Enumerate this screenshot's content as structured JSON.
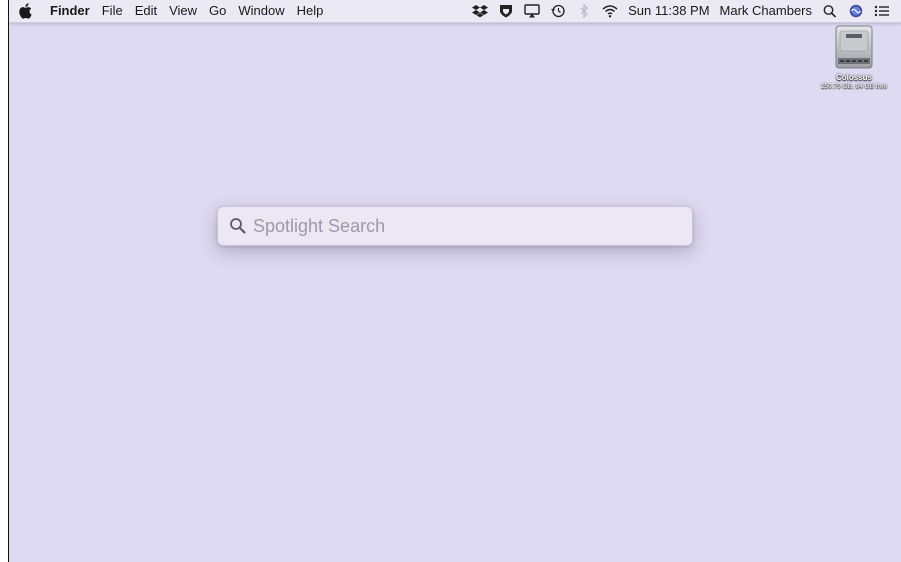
{
  "menubar": {
    "apple_icon": "apple-logo-icon",
    "app_name": "Finder",
    "menus": [
      "File",
      "Edit",
      "View",
      "Go",
      "Window",
      "Help"
    ],
    "tray": {
      "icons": [
        "dropbox-icon",
        "shield-icon",
        "airplay-icon",
        "time-machine-icon",
        "bluetooth-icon",
        "wifi-icon"
      ],
      "clock": "Sun 11:38 PM",
      "user": "Mark Chambers",
      "right_icons": [
        "search-icon",
        "siri-icon",
        "notification-center-icon"
      ]
    }
  },
  "desktop": {
    "background_color": "#dedaf1",
    "drive": {
      "name": "Colossus",
      "info": "250.79 GB, 84 GB free"
    }
  },
  "spotlight": {
    "placeholder": "Spotlight Search",
    "value": ""
  }
}
